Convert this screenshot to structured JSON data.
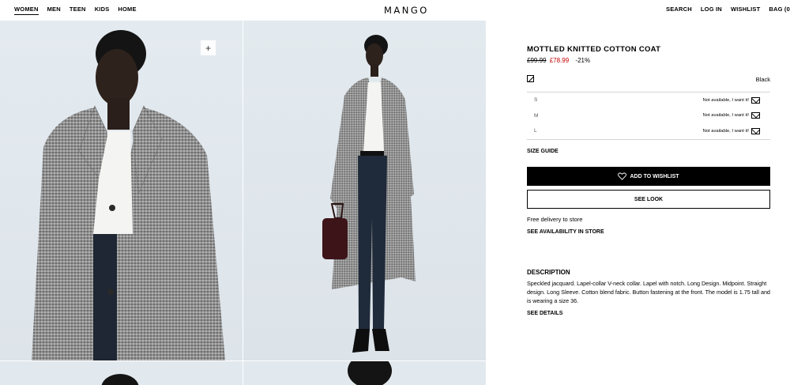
{
  "header": {
    "nav_left": [
      "WOMEN",
      "MEN",
      "TEEN",
      "KIDS",
      "HOME"
    ],
    "logo": "MANGO",
    "nav_right": [
      "SEARCH",
      "LOG IN",
      "WISHLIST",
      "BAG (0"
    ]
  },
  "product": {
    "title": "MOTTLED KNITTED COTTON COAT",
    "price_old": "£99.99",
    "price_new": "£78.99",
    "discount": "-21%",
    "color": "Black",
    "sizes": [
      {
        "label": "S",
        "status": "Not available, I want it!"
      },
      {
        "label": "M",
        "status": "Not available, I want it!"
      },
      {
        "label": "L",
        "status": "Not available, I want it!"
      }
    ],
    "size_guide": "SIZE GUIDE",
    "add_wishlist": "ADD TO WISHLIST",
    "see_look": "SEE LOOK",
    "delivery": "Free delivery to store",
    "availability": "SEE AVAILABILITY IN STORE",
    "description_title": "DESCRIPTION",
    "description_text": "Speckled jacquard. Lapel-collar V-neck collar. Lapel with notch. Long Design. Midpoint. Straight design. Long Sleeve. Cotton blend fabric. Button fastening at the front. The model is 1.75 tall and is wearing a size 36.",
    "see_details": "SEE DETAILS"
  },
  "colors": {
    "accent_price": "#c00000",
    "button_bg": "#000000",
    "image_bg": "#e2e9ee",
    "coat_grey": "#9a9a9a"
  }
}
